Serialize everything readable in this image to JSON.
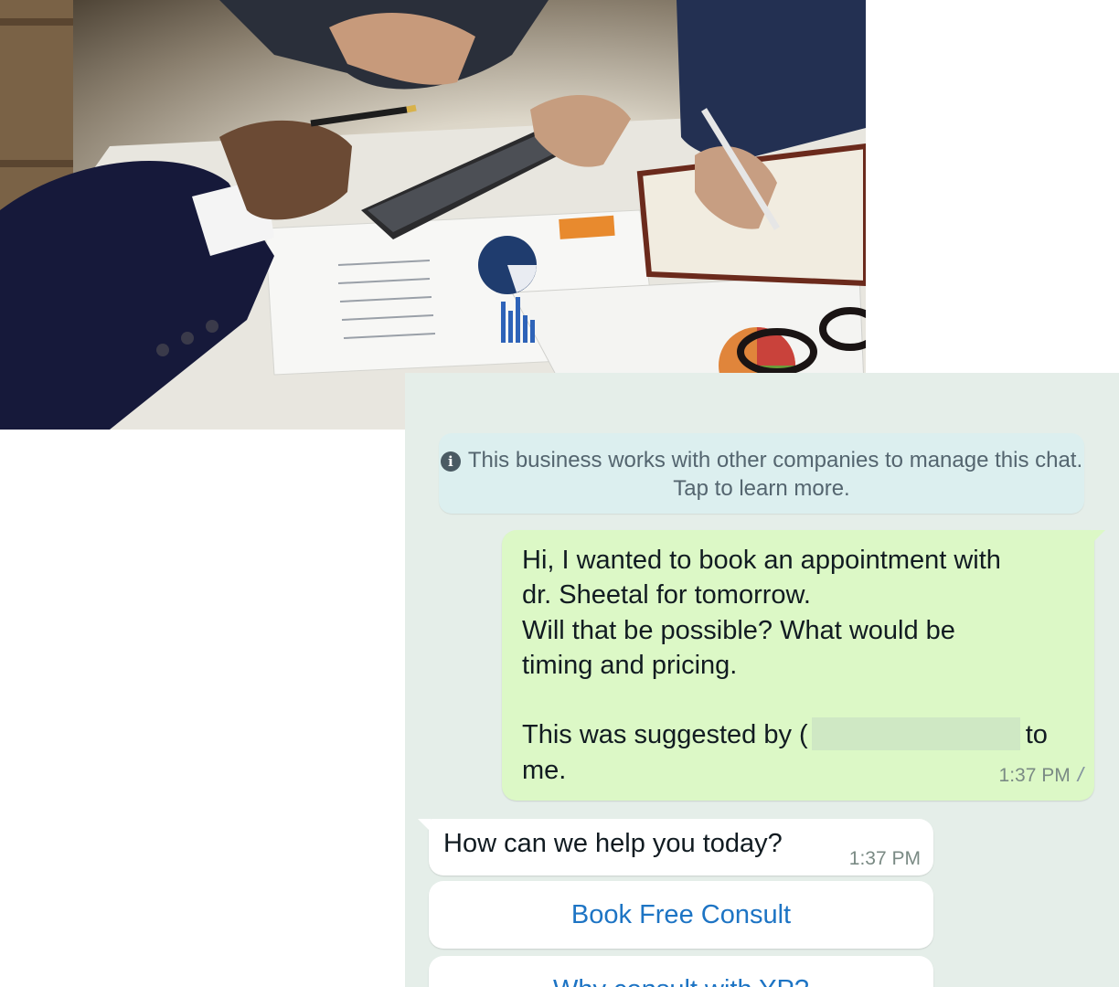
{
  "photo": {
    "alt_icon": "business-meeting-photo"
  },
  "chat": {
    "system_note": "This business works with other companies to manage this chat. Tap to learn more.",
    "outgoing": {
      "lines": [
        "Hi, I wanted to book an appointment with",
        "dr. Sheetal for tomorrow.",
        "Will that be possible? What would be",
        "timing and pricing.",
        "",
        "This was suggested by (",
        "me."
      ],
      "after_redaction": "to",
      "time": "1:37 PM"
    },
    "incoming": {
      "text": "How can we help you today?",
      "time": "1:37 PM"
    },
    "quick_replies": [
      "Book Free Consult",
      "Why consult with YP?"
    ]
  },
  "colors": {
    "chat_bg": "#e5eee9",
    "outgoing_bubble": "#dcf8c6",
    "system_note_bg": "#dcefef",
    "quick_reply_text": "#1d74c4"
  }
}
